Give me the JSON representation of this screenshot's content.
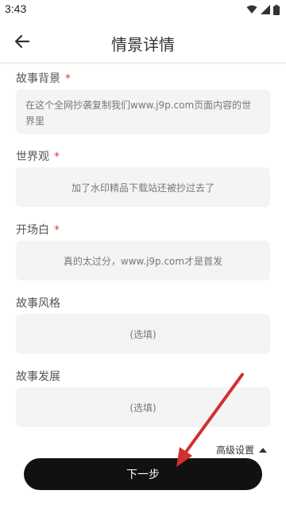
{
  "status_bar": {
    "time": "3:43"
  },
  "header": {
    "title": "情景详情"
  },
  "form": {
    "story_background": {
      "label": "故事背景",
      "required": "*",
      "value": "在这个全网抄袭复制我们www.j9p.com页面内容的世界里"
    },
    "worldview": {
      "label": "世界观",
      "required": "*",
      "value": "加了水印精品下载站还被抄过去了"
    },
    "opening": {
      "label": "开场白",
      "required": "*",
      "value": "真的太过分，www.j9p.com才是首发"
    },
    "story_style": {
      "label": "故事风格",
      "placeholder": "(选填)"
    },
    "story_development": {
      "label": "故事发展",
      "placeholder": "(选填)"
    }
  },
  "footer": {
    "advanced_settings": "高级设置",
    "next_button": "下一步"
  },
  "colors": {
    "accent": "#111111",
    "required": "#e53935",
    "field_bg": "#f4f4f6",
    "annotation_arrow": "#d32f2f"
  }
}
